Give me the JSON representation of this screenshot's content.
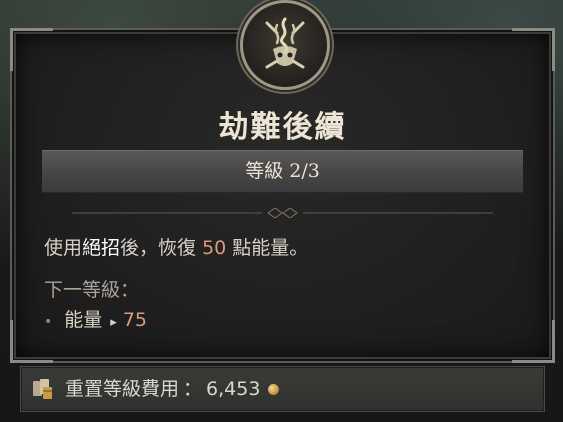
{
  "skill": {
    "title": "劫難後續",
    "rank_label": "等級 2/3"
  },
  "description": {
    "prefix": "使用",
    "keyword": "絕招",
    "middle": "後，恢復 ",
    "amount": "50",
    "suffix": " 點能量。"
  },
  "next_rank": {
    "label": "下一等級：",
    "bullet": "•",
    "stat_name": "能量",
    "arrow": "▸",
    "stat_value": "75"
  },
  "reset_cost": {
    "label": "重置等級費用",
    "separator": "：",
    "value": "6,453"
  },
  "icons": {
    "emblem": "skill-emblem-icon",
    "cost": "respec-cost-icon",
    "gold": "gold-coin-icon"
  },
  "colors": {
    "title": "#ece4d4",
    "highlight_number": "#d99a84",
    "panel_border": "#5a5c57"
  }
}
